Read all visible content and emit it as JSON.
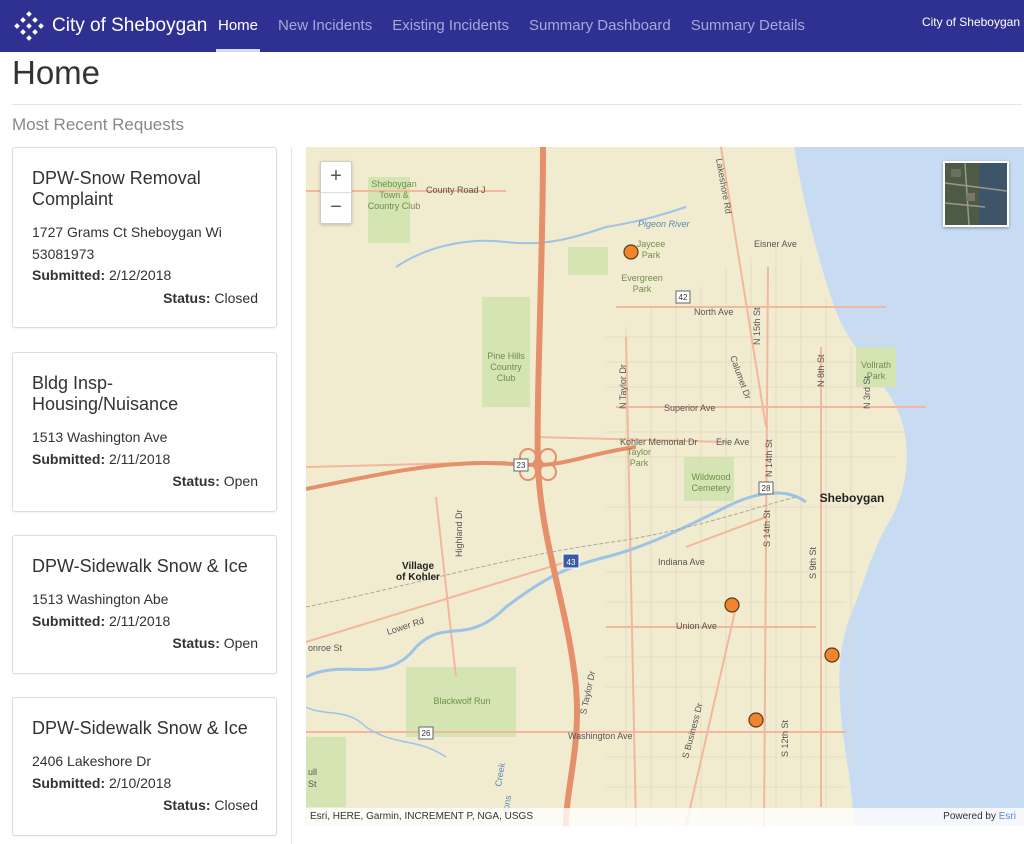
{
  "header": {
    "brand": "City of Sheboygan",
    "nav": [
      "Home",
      "New Incidents",
      "Existing Incidents",
      "Summary Dashboard",
      "Summary Details"
    ],
    "active_index": 0,
    "user": "City of Sheboygan"
  },
  "page": {
    "title": "Home",
    "section_title": "Most Recent Requests"
  },
  "requests": [
    {
      "title": "DPW-Snow Removal Complaint",
      "address": "1727 Grams Ct Sheboygan Wi 53081973",
      "submitted_label": "Submitted:",
      "submitted": "2/12/2018",
      "status_label": "Status:",
      "status": "Closed"
    },
    {
      "title": "Bldg Insp-Housing/Nuisance",
      "address": "1513 Washington Ave",
      "submitted_label": "Submitted:",
      "submitted": "2/11/2018",
      "status_label": "Status:",
      "status": "Open"
    },
    {
      "title": "DPW-Sidewalk Snow & Ice",
      "address": "1513 Washington Abe",
      "submitted_label": "Submitted:",
      "submitted": "2/11/2018",
      "status_label": "Status:",
      "status": "Open"
    },
    {
      "title": "DPW-Sidewalk Snow & Ice",
      "address": "2406 Lakeshore Dr",
      "submitted_label": "Submitted:",
      "submitted": "2/10/2018",
      "status_label": "Status:",
      "status": "Closed"
    }
  ],
  "map": {
    "zoom_in": "+",
    "zoom_out": "−",
    "labels": {
      "sheboygan": "Sheboygan",
      "village": "Village",
      "of_kohler": "of Kohler",
      "county_road": "County Road J",
      "pigeon_river": "Pigeon River",
      "eisner": "Eisner Ave",
      "north_ave": "North Ave",
      "superior": "Superior Ave",
      "kohler_memorial": "Kohler Memorial Dr",
      "erie": "Erie Ave",
      "indiana": "Indiana Ave",
      "union": "Union Ave",
      "washington": "Washington Ave",
      "lower_rd": "Lower Rd",
      "monroe": "onroe St",
      "highland": "Highland Dr",
      "n_taylor": "N Taylor Dr",
      "s_taylor": "S Taylor Dr",
      "n15": "N 15th St",
      "n14": "N 14th St",
      "n8": "N 8th St",
      "n3": "N 3rd St",
      "s14": "S 14th St",
      "s9": "S 9th St",
      "s12": "S 12th St",
      "calumet": "Calumet Dr",
      "business": "S Business Dr",
      "lakeshore": "Lakeshore Rd",
      "creek": "Creek",
      "golf1": "Sheboygan",
      "golf1b": "Town &",
      "golf1c": "Country Club",
      "golf2": "Pine Hills",
      "golf2b": "Country",
      "golf2c": "Club",
      "blackwolf": "Blackwolf Run",
      "jaycee": "Jaycee",
      "jaycee2": "Park",
      "evergreen": "Evergreen",
      "evergreen2": "Park",
      "taylor_park": "Taylor",
      "taylor_park2": "Park",
      "vollrath": "Vollrath",
      "vollrath2": "Park",
      "wildwood": "Wildwood",
      "wildwood2": "Cemetery",
      "dons": "dons",
      "ull": "ull",
      "st": "St",
      "shield_42": "42",
      "shield_23": "23",
      "shield_28": "28",
      "shield_43": "43",
      "shield_26": "26"
    },
    "attribution": "Esri, HERE, Garmin, INCREMENT P, NGA, USGS",
    "powered_by": "Powered by",
    "esri": "Esri"
  }
}
